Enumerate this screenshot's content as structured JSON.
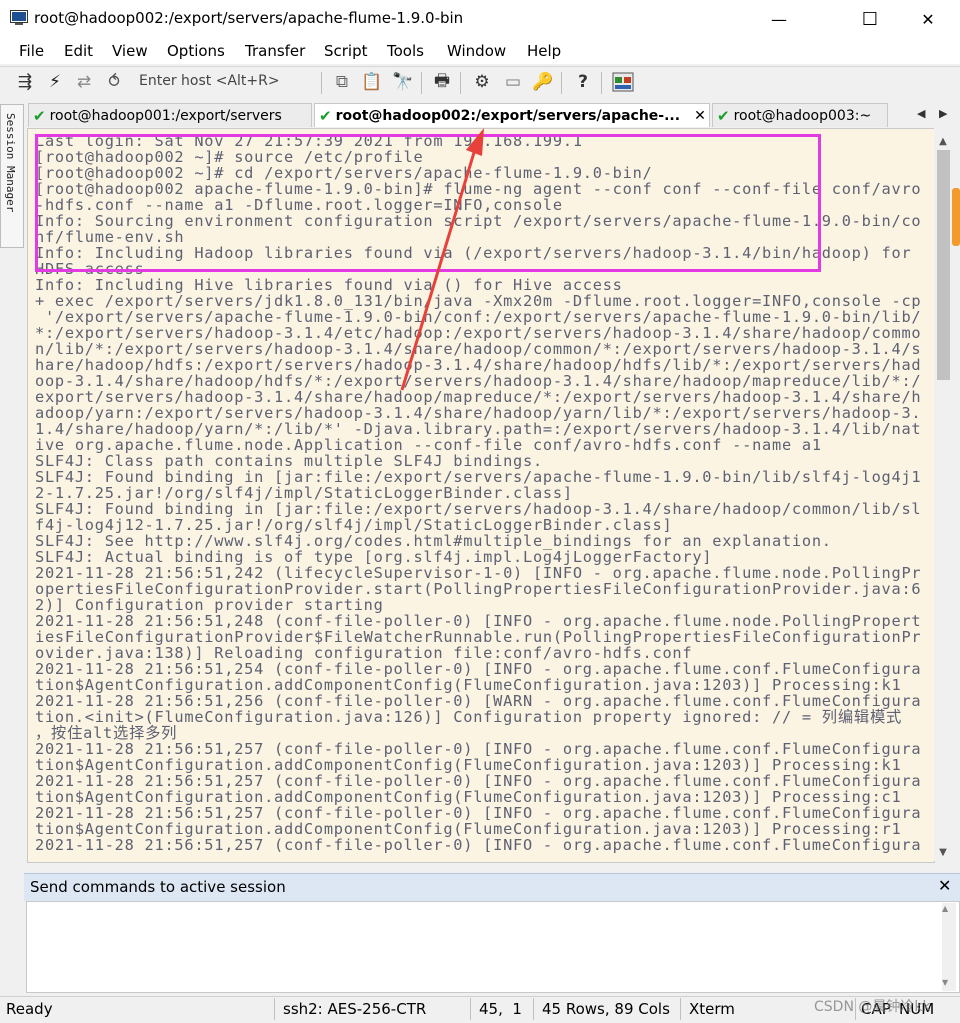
{
  "window": {
    "title": "root@hadoop002:/export/servers/apache-flume-1.9.0-bin",
    "minimize_glyph": "—",
    "maximize_glyph": "☐",
    "close_glyph": "✕"
  },
  "menu": [
    "File",
    "Edit",
    "View",
    "Options",
    "Transfer",
    "Script",
    "Tools",
    "Window",
    "Help"
  ],
  "toolbar": {
    "enter_host_placeholder": "Enter host <Alt+R>",
    "icons": [
      "connect-icon",
      "lightning-icon",
      "reconnect-icon",
      "disconnect-icon",
      "copy-icon",
      "paste-icon",
      "find-icon",
      "print-icon",
      "settings-icon",
      "keymap-icon",
      "key-icon",
      "help-icon",
      "sftp-icon"
    ]
  },
  "session_manager": {
    "label": "Session Manager"
  },
  "tabs": [
    {
      "label": "root@hadoop001:/export/servers",
      "active": false
    },
    {
      "label": "root@hadoop002:/export/servers/apache-...",
      "active": true,
      "close": "✕"
    },
    {
      "label": "root@hadoop003:~",
      "active": false
    }
  ],
  "tab_nav": {
    "prev": "◀",
    "next": "▶"
  },
  "terminal": {
    "lines": [
      "Last login: Sat Nov 27 21:57:39 2021 from 192.168.199.1",
      "[root@hadoop002 ~]# source /etc/profile",
      "[root@hadoop002 ~]# cd /export/servers/apache-flume-1.9.0-bin/",
      "[root@hadoop002 apache-flume-1.9.0-bin]# flume-ng agent --conf conf --conf-file conf/avro",
      "-hdfs.conf --name a1 -Dflume.root.logger=INFO,console",
      "Info: Sourcing environment configuration script /export/servers/apache-flume-1.9.0-bin/co",
      "nf/flume-env.sh",
      "Info: Including Hadoop libraries found via (/export/servers/hadoop-3.1.4/bin/hadoop) for",
      "HDFS access",
      "Info: Including Hive libraries found via () for Hive access",
      "+ exec /export/servers/jdk1.8.0_131/bin/java -Xmx20m -Dflume.root.logger=INFO,console -cp",
      " '/export/servers/apache-flume-1.9.0-bin/conf:/export/servers/apache-flume-1.9.0-bin/lib/",
      "*:/export/servers/hadoop-3.1.4/etc/hadoop:/export/servers/hadoop-3.1.4/share/hadoop/commo",
      "n/lib/*:/export/servers/hadoop-3.1.4/share/hadoop/common/*:/export/servers/hadoop-3.1.4/s",
      "hare/hadoop/hdfs:/export/servers/hadoop-3.1.4/share/hadoop/hdfs/lib/*:/export/servers/had",
      "oop-3.1.4/share/hadoop/hdfs/*:/export/servers/hadoop-3.1.4/share/hadoop/mapreduce/lib/*:/",
      "export/servers/hadoop-3.1.4/share/hadoop/mapreduce/*:/export/servers/hadoop-3.1.4/share/h",
      "adoop/yarn:/export/servers/hadoop-3.1.4/share/hadoop/yarn/lib/*:/export/servers/hadoop-3.",
      "1.4/share/hadoop/yarn/*:/lib/*' -Djava.library.path=:/export/servers/hadoop-3.1.4/lib/nat",
      "ive org.apache.flume.node.Application --conf-file conf/avro-hdfs.conf --name a1",
      "SLF4J: Class path contains multiple SLF4J bindings.",
      "SLF4J: Found binding in [jar:file:/export/servers/apache-flume-1.9.0-bin/lib/slf4j-log4j1",
      "2-1.7.25.jar!/org/slf4j/impl/StaticLoggerBinder.class]",
      "SLF4J: Found binding in [jar:file:/export/servers/hadoop-3.1.4/share/hadoop/common/lib/sl",
      "f4j-log4j12-1.7.25.jar!/org/slf4j/impl/StaticLoggerBinder.class]",
      "SLF4J: See http://www.slf4j.org/codes.html#multiple_bindings for an explanation.",
      "SLF4J: Actual binding is of type [org.slf4j.impl.Log4jLoggerFactory]",
      "2021-11-28 21:56:51,242 (lifecycleSupervisor-1-0) [INFO - org.apache.flume.node.PollingPr",
      "opertiesFileConfigurationProvider.start(PollingPropertiesFileConfigurationProvider.java:6",
      "2)] Configuration provider starting",
      "2021-11-28 21:56:51,248 (conf-file-poller-0) [INFO - org.apache.flume.node.PollingPropert",
      "iesFileConfigurationProvider$FileWatcherRunnable.run(PollingPropertiesFileConfigurationPr",
      "ovider.java:138)] Reloading configuration file:conf/avro-hdfs.conf",
      "2021-11-28 21:56:51,254 (conf-file-poller-0) [INFO - org.apache.flume.conf.FlumeConfigura",
      "tion$AgentConfiguration.addComponentConfig(FlumeConfiguration.java:1203)] Processing:k1",
      "2021-11-28 21:56:51,256 (conf-file-poller-0) [WARN - org.apache.flume.conf.FlumeConfigura",
      "tion.<init>(FlumeConfiguration.java:126)] Configuration property ignored: // = 列编辑模式",
      "，按住alt选择多列",
      "2021-11-28 21:56:51,257 (conf-file-poller-0) [INFO - org.apache.flume.conf.FlumeConfigura",
      "tion$AgentConfiguration.addComponentConfig(FlumeConfiguration.java:1203)] Processing:k1",
      "2021-11-28 21:56:51,257 (conf-file-poller-0) [INFO - org.apache.flume.conf.FlumeConfigura",
      "tion$AgentConfiguration.addComponentConfig(FlumeConfiguration.java:1203)] Processing:c1",
      "2021-11-28 21:56:51,257 (conf-file-poller-0) [INFO - org.apache.flume.conf.FlumeConfigura",
      "tion$AgentConfiguration.addComponentConfig(FlumeConfiguration.java:1203)] Processing:r1",
      "2021-11-28 21:56:51,257 (conf-file-poller-0) [INFO - org.apache.flume.conf.FlumeConfigura"
    ]
  },
  "send_commands": {
    "label": "Send commands to active session",
    "close": "✕"
  },
  "status": {
    "ready": "Ready",
    "cipher": "ssh2: AES-256-CTR",
    "cursor": "45,  1",
    "size": "45 Rows, 89 Cols",
    "term": "Xterm",
    "caps": "CAP",
    "num": "NUM"
  },
  "watermark": "CSDN @晨钟冷kk",
  "colors": {
    "terminal_bg": "#fbf4e3",
    "terminal_fg": "#5d6172",
    "annotation": "#e43ae4",
    "arrow": "#e8403a"
  }
}
